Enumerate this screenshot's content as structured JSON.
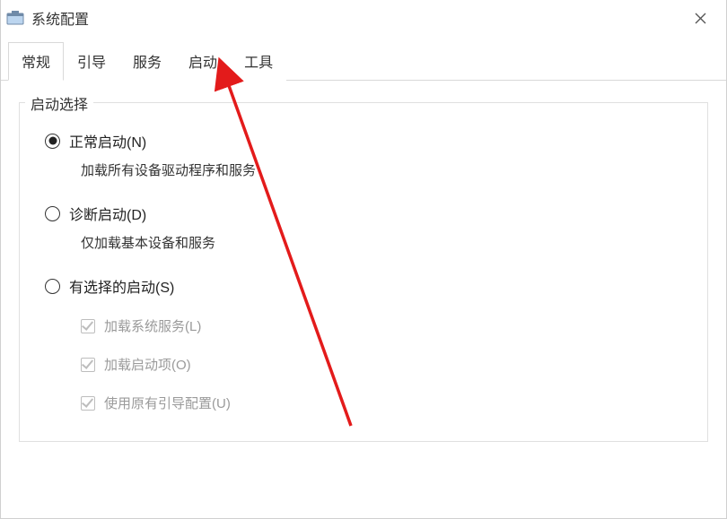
{
  "window": {
    "title": "系统配置"
  },
  "tabs": {
    "t0": "常规",
    "t1": "引导",
    "t2": "服务",
    "t3": "启动",
    "t4": "工具",
    "active_index": 0
  },
  "group": {
    "legend": "启动选择",
    "options": {
      "normal": {
        "label": "正常启动(N)",
        "desc": "加载所有设备驱动程序和服务",
        "checked": true
      },
      "diag": {
        "label": "诊断启动(D)",
        "desc": "仅加载基本设备和服务",
        "checked": false
      },
      "selective": {
        "label": "有选择的启动(S)",
        "checked": false,
        "subs": {
          "s0": {
            "label": "加载系统服务(L)",
            "checked": true,
            "disabled": true
          },
          "s1": {
            "label": "加载启动项(O)",
            "checked": true,
            "disabled": true
          },
          "s2": {
            "label": "使用原有引导配置(U)",
            "checked": true,
            "disabled": true
          }
        }
      }
    }
  },
  "annotation": {
    "arrow_target": "tab-tools"
  }
}
